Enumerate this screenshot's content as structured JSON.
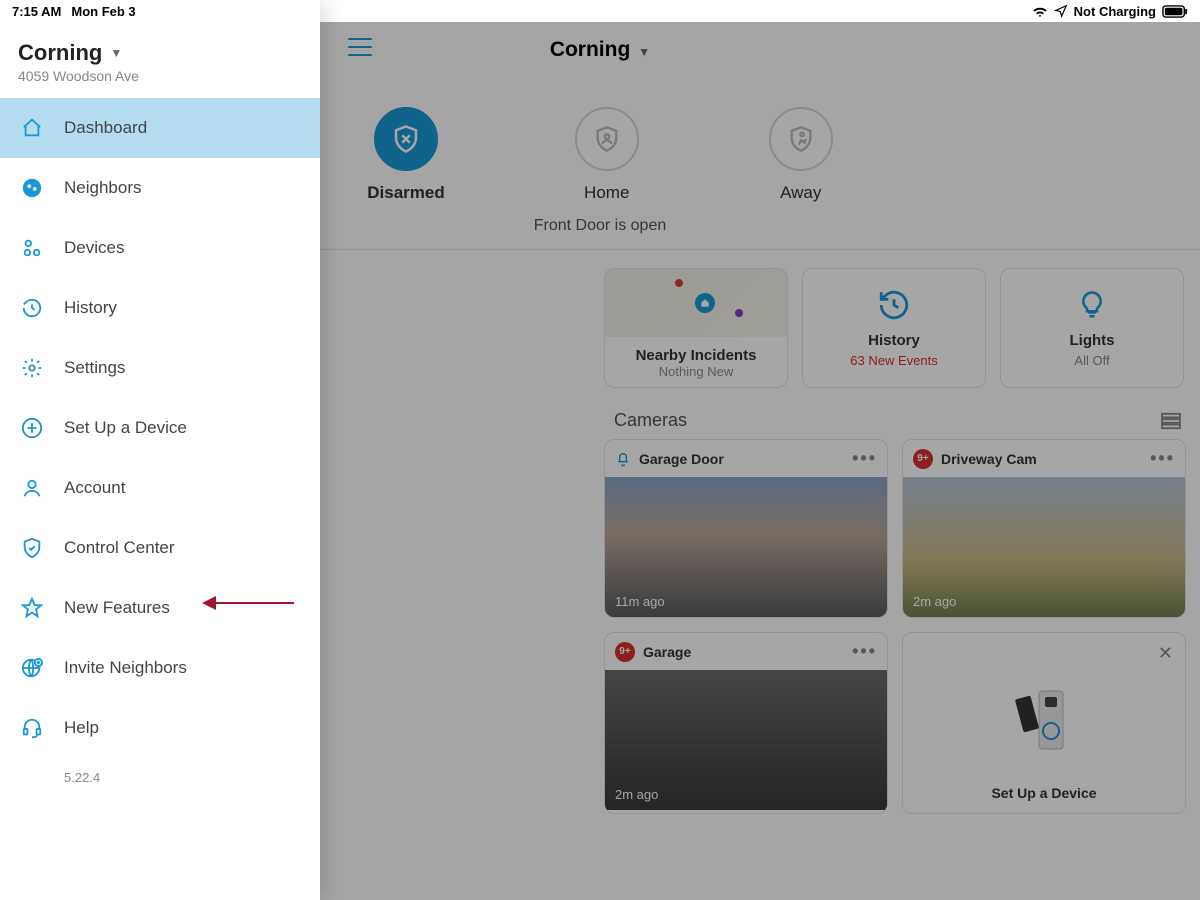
{
  "status": {
    "time": "7:15 AM",
    "date": "Mon Feb 3",
    "charging": "Not Charging"
  },
  "sidebar": {
    "location_name": "Corning",
    "location_address": "4059 Woodson Ave",
    "items": [
      {
        "label": "Dashboard",
        "icon": "home-icon"
      },
      {
        "label": "Neighbors",
        "icon": "globe-icon"
      },
      {
        "label": "Devices",
        "icon": "devices-icon"
      },
      {
        "label": "History",
        "icon": "history-icon"
      },
      {
        "label": "Settings",
        "icon": "gear-icon"
      },
      {
        "label": "Set Up a Device",
        "icon": "plus-circle-icon"
      },
      {
        "label": "Account",
        "icon": "person-icon"
      },
      {
        "label": "Control Center",
        "icon": "shield-check-icon"
      },
      {
        "label": "New Features",
        "icon": "star-icon"
      },
      {
        "label": "Invite Neighbors",
        "icon": "globe-plus-icon"
      },
      {
        "label": "Help",
        "icon": "headset-icon"
      }
    ],
    "active_index": 0,
    "version": "5.22.4"
  },
  "header": {
    "title": "Corning"
  },
  "modes": {
    "items": [
      {
        "label": "Disarmed",
        "active": true
      },
      {
        "label": "Home",
        "active": false
      },
      {
        "label": "Away",
        "active": false
      }
    ],
    "alert": "Front Door is open"
  },
  "cards": [
    {
      "title": "Nearby Incidents",
      "subtitle": "Nothing New",
      "kind": "map"
    },
    {
      "title": "History",
      "subtitle": "63 New Events",
      "kind": "history"
    },
    {
      "title": "Lights",
      "subtitle": "All Off",
      "kind": "lights"
    }
  ],
  "cameras": {
    "heading": "Cameras",
    "items": [
      {
        "name": "Garage Door",
        "timestamp": "11m ago",
        "badge": null,
        "promo": false
      },
      {
        "name": "Driveway Cam",
        "timestamp": "2m ago",
        "badge": "9+",
        "promo": false
      },
      {
        "name": "Garage",
        "timestamp": "2m ago",
        "badge": "9+",
        "promo": false
      },
      {
        "name": "",
        "timestamp": "",
        "badge": null,
        "promo": true,
        "promo_label": "Set Up a Device"
      }
    ]
  },
  "colors": {
    "accent": "#1998d5",
    "danger": "#d82e2e"
  }
}
